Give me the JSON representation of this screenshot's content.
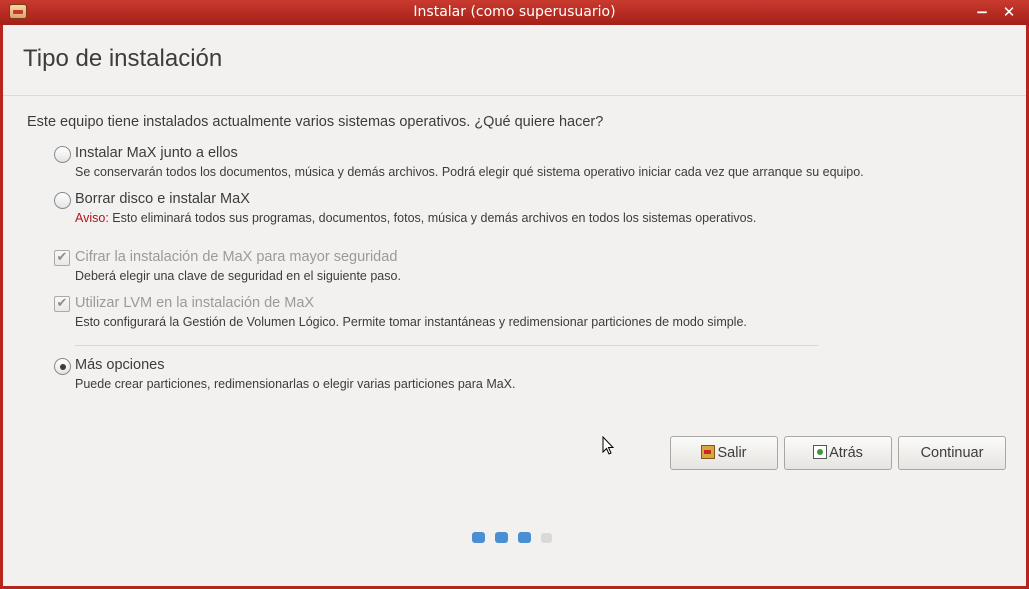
{
  "window": {
    "title": "Instalar (como superusuario)",
    "minimize_glyph": "−",
    "close_glyph": "✕",
    "accent": "#b8241e"
  },
  "header": {
    "title": "Tipo de instalación"
  },
  "question": "Este equipo tiene instalados actualmente varios sistemas operativos. ¿Qué quiere hacer?",
  "options": [
    {
      "type": "radio",
      "checked": false,
      "label": "Instalar MaX junto a ellos",
      "description": "Se conservarán todos los documentos, música y demás archivos. Podrá elegir qué sistema operativo iniciar cada vez que arranque su equipo."
    },
    {
      "type": "radio",
      "checked": false,
      "label": "Borrar disco e instalar MaX",
      "warning_prefix": "Aviso:",
      "description": " Esto eliminará todos sus programas, documentos, fotos, música y demás archivos en todos los sistemas operativos."
    },
    {
      "type": "checkbox",
      "checked": true,
      "disabled": true,
      "label": "Cifrar la instalación de MaX para mayor seguridad",
      "description": "Deberá elegir una clave de seguridad en el siguiente paso."
    },
    {
      "type": "checkbox",
      "checked": true,
      "disabled": true,
      "label": "Utilizar LVM en la instalación de MaX",
      "description": "Esto configurará la Gestión de Volumen Lógico. Permite tomar instantáneas y redimensionar particiones de modo simple."
    },
    {
      "type": "radio",
      "checked": true,
      "label": "Más opciones",
      "description": "Puede crear particiones, redimensionarlas o elegir varias particiones para MaX."
    }
  ],
  "buttons": {
    "quit": "Salir",
    "back": "Atrás",
    "continue": "Continuar"
  },
  "progress": {
    "total_steps": 4,
    "completed_steps": 3,
    "active_color": "#4a8fd3",
    "inactive_color": "#d9d9d9"
  }
}
